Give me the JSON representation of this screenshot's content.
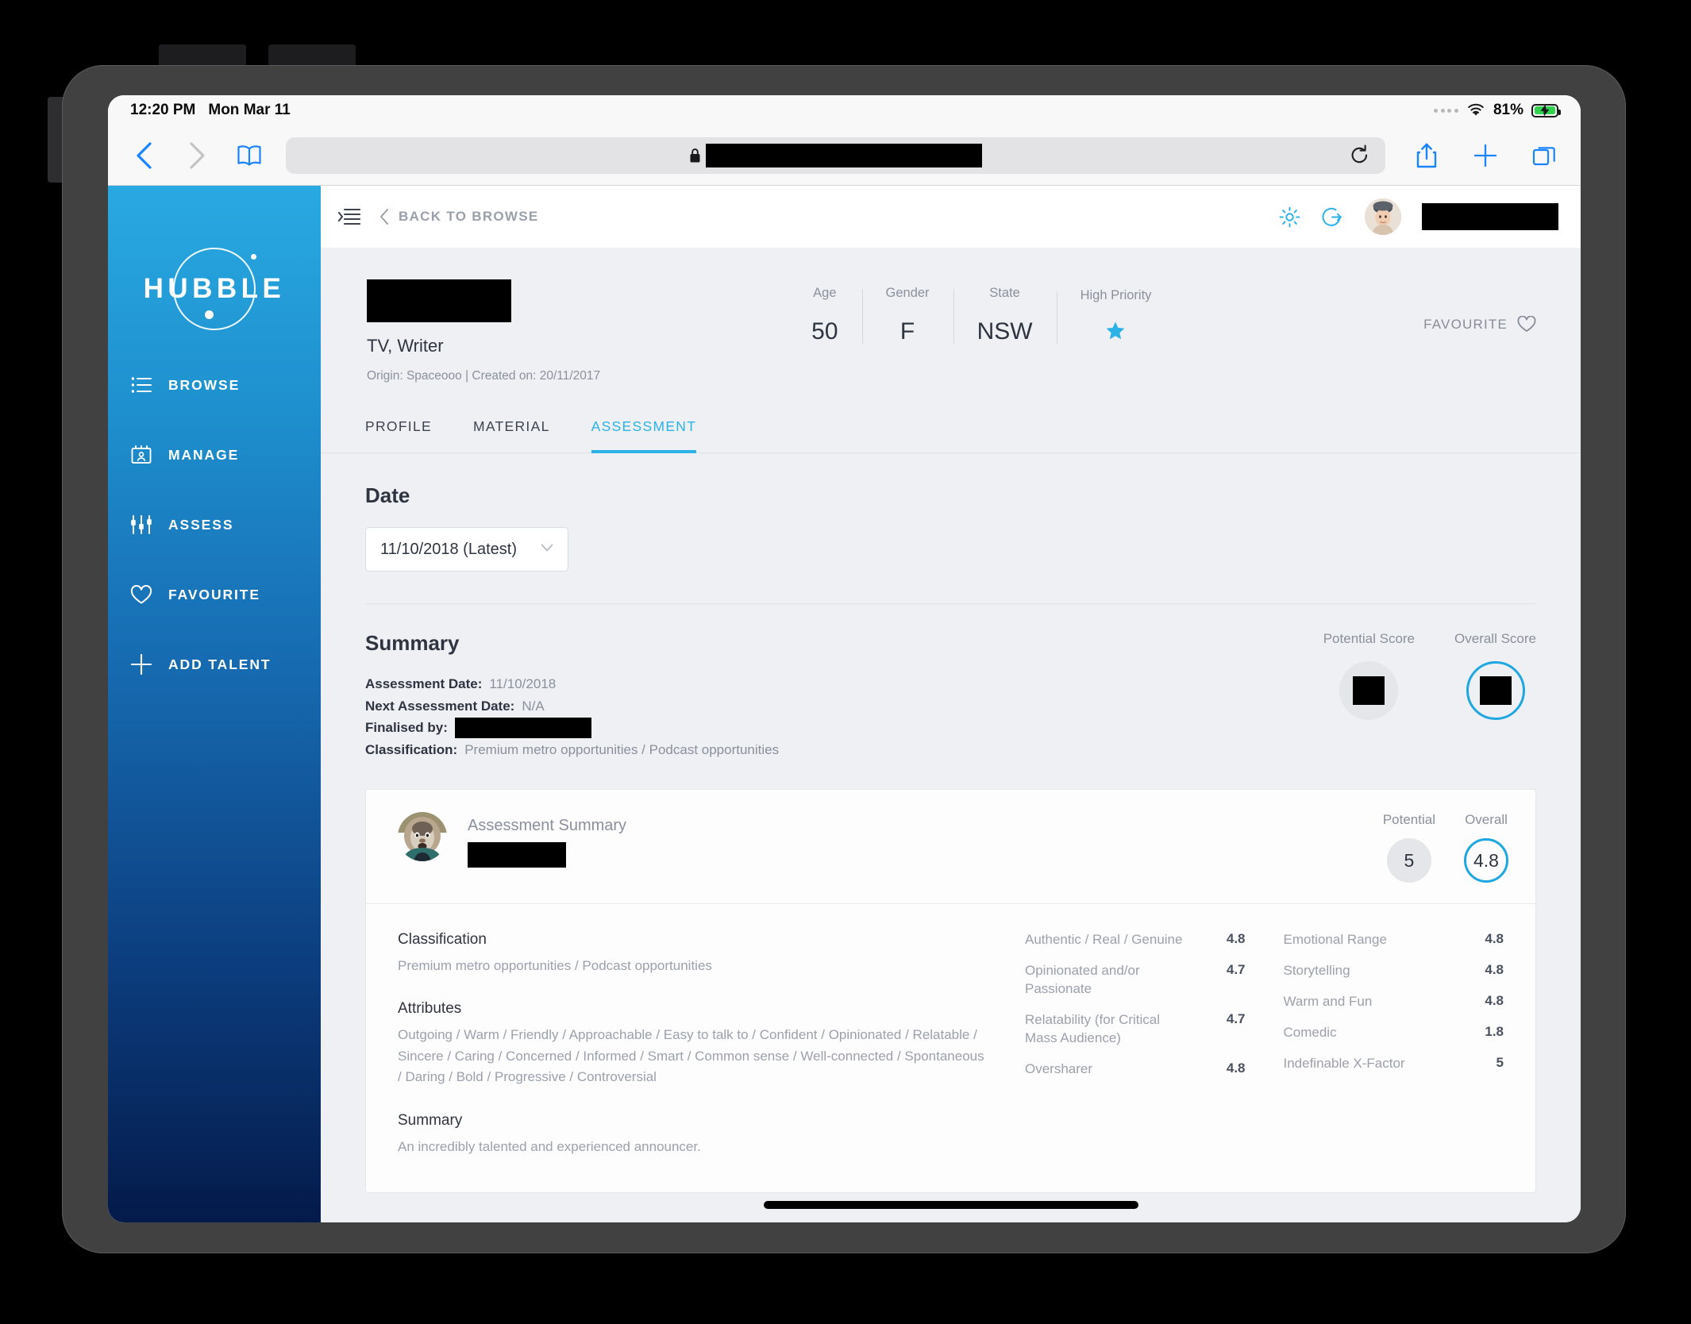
{
  "status_bar": {
    "time": "12:20 PM",
    "date": "Mon Mar 11",
    "battery_percent": "81%",
    "wifi_icon": "wifi-icon",
    "battery_icon": "battery-charging-icon"
  },
  "browser": {
    "back_icon": "chevron-left-icon",
    "forward_icon": "chevron-right-icon",
    "bookmarks_icon": "book-icon",
    "lock_icon": "lock-icon",
    "url": "",
    "reload_icon": "reload-icon",
    "share_icon": "share-icon",
    "new_tab_icon": "plus-icon",
    "tabs_icon": "tabs-icon"
  },
  "sidebar": {
    "logo_text": "HUBBLE",
    "items": [
      {
        "label": "BROWSE",
        "icon": "list-icon"
      },
      {
        "label": "MANAGE",
        "icon": "contact-card-icon"
      },
      {
        "label": "ASSESS",
        "icon": "sliders-icon"
      },
      {
        "label": "FAVOURITE",
        "icon": "heart-icon"
      },
      {
        "label": "ADD TALENT",
        "icon": "plus-icon"
      }
    ]
  },
  "topbar": {
    "menu_icon": "collapse-sidebar-icon",
    "back_label": "BACK TO BROWSE",
    "back_icon": "chevron-left-icon",
    "settings_icon": "gear-icon",
    "logout_icon": "logout-icon",
    "avatar": "user-avatar",
    "username": ""
  },
  "profile": {
    "name": "",
    "title": "TV, Writer",
    "origin": "Origin: Spaceooo   |   Created on: 20/11/2017",
    "stats": [
      {
        "label": "Age",
        "value": "50"
      },
      {
        "label": "Gender",
        "value": "F"
      },
      {
        "label": "State",
        "value": "NSW"
      },
      {
        "label": "High Priority",
        "value": "★"
      }
    ],
    "favourite_label": "FAVOURITE",
    "favourite_icon": "heart-outline-icon"
  },
  "tabs": [
    {
      "label": "PROFILE",
      "active": false
    },
    {
      "label": "MATERIAL",
      "active": false
    },
    {
      "label": "ASSESSMENT",
      "active": true
    }
  ],
  "date_section": {
    "heading": "Date",
    "selected": "11/10/2018 (Latest)",
    "chevron_icon": "chevron-down-icon"
  },
  "summary": {
    "heading": "Summary",
    "assessment_date_label": "Assessment Date:",
    "assessment_date_value": "11/10/2018",
    "next_assessment_label": "Next Assessment Date:",
    "next_assessment_value": "N/A",
    "finalised_by_label": "Finalised by:",
    "finalised_by_value": "",
    "classification_label": "Classification:",
    "classification_value": "Premium metro opportunities / Podcast opportunities",
    "potential_score_label": "Potential Score",
    "overall_score_label": "Overall Score",
    "potential_score_value": "",
    "overall_score_value": ""
  },
  "card": {
    "avatar": "orangutan-avatar",
    "title": "Assessment Summary",
    "author": "",
    "potential_label": "Potential",
    "overall_label": "Overall",
    "potential_value": "5",
    "overall_value": "4.8",
    "classification_heading": "Classification",
    "classification_text": "Premium metro opportunities / Podcast opportunities",
    "attributes_heading": "Attributes",
    "attributes_text": "Outgoing / Warm / Friendly / Approachable / Easy to talk to / Confident / Opinionated / Relatable / Sincere / Caring / Concerned / Informed / Smart / Common sense / Well-connected / Spontaneous / Daring / Bold / Progressive / Controversial",
    "summary_heading": "Summary",
    "summary_text": "An incredibly talented and experienced announcer.",
    "scores_col1": [
      {
        "name": "Authentic / Real / Genuine",
        "value": "4.8"
      },
      {
        "name": "Opinionated and/or Passionate",
        "value": "4.7"
      },
      {
        "name": "Relatability (for Critical Mass Audience)",
        "value": "4.7"
      },
      {
        "name": "Oversharer",
        "value": "4.8"
      }
    ],
    "scores_col2": [
      {
        "name": "Emotional Range",
        "value": "4.8"
      },
      {
        "name": "Storytelling",
        "value": "4.8"
      },
      {
        "name": "Warm and Fun",
        "value": "4.8"
      },
      {
        "name": "Comedic",
        "value": "1.8"
      },
      {
        "name": "Indefinable X-Factor",
        "value": "5"
      }
    ]
  },
  "colors": {
    "accent": "#2bb3e8",
    "sidebar_top": "#29a9e1",
    "sidebar_bottom": "#041a4a",
    "ios_blue": "#1a84ff",
    "battery_green": "#32d251"
  }
}
